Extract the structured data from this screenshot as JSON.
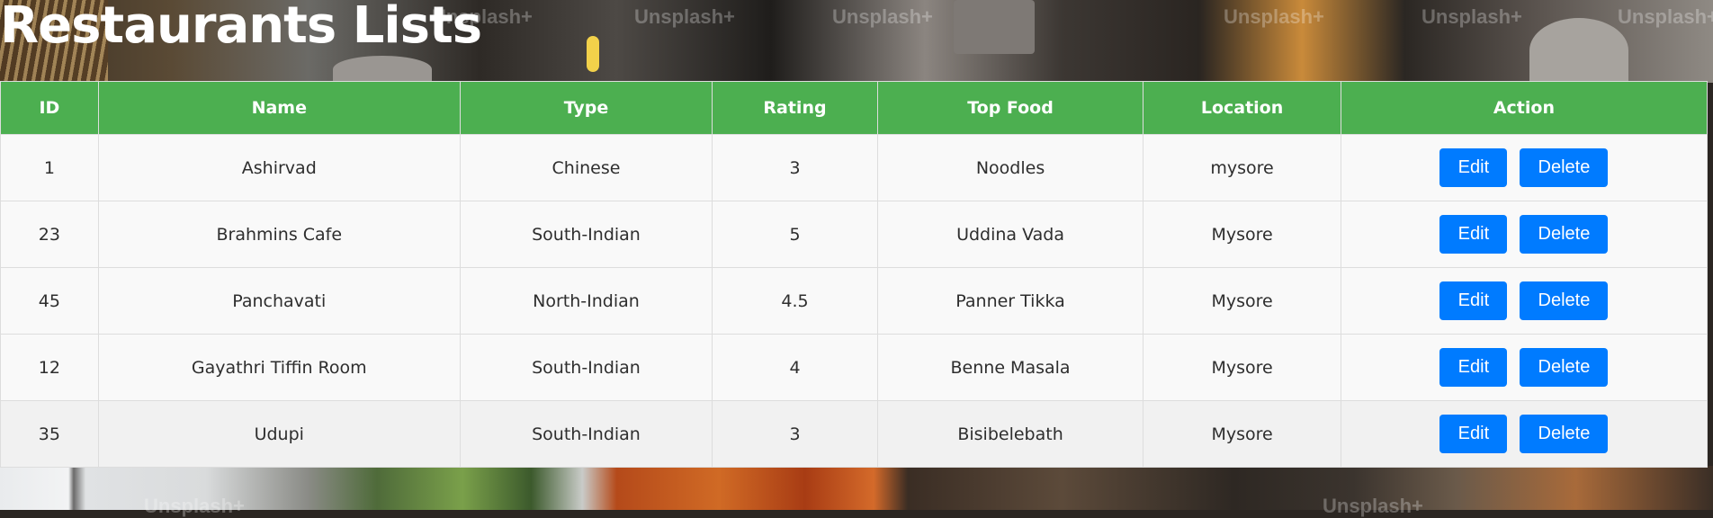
{
  "page": {
    "title": "Restaurants Lists",
    "watermark_text": "Unsplash+"
  },
  "colors": {
    "header_bg": "#4caf50",
    "button_bg": "#007bff",
    "row_bg": "#f9f9f9",
    "title_color": "#ffffff"
  },
  "table": {
    "columns": [
      "ID",
      "Name",
      "Type",
      "Rating",
      "Top Food",
      "Location",
      "Action"
    ],
    "edit_label": "Edit",
    "delete_label": "Delete",
    "rows": [
      {
        "id": "1",
        "name": "Ashirvad",
        "type": "Chinese",
        "rating": "3",
        "top_food": "Noodles",
        "location": "mysore"
      },
      {
        "id": "23",
        "name": "Brahmins Cafe",
        "type": "South-Indian",
        "rating": "5",
        "top_food": "Uddina Vada",
        "location": "Mysore"
      },
      {
        "id": "45",
        "name": "Panchavati",
        "type": "North-Indian",
        "rating": "4.5",
        "top_food": "Panner Tikka",
        "location": "Mysore"
      },
      {
        "id": "12",
        "name": "Gayathri Tiffin Room",
        "type": "South-Indian",
        "rating": "4",
        "top_food": "Benne Masala",
        "location": "Mysore"
      },
      {
        "id": "35",
        "name": "Udupi",
        "type": "South-Indian",
        "rating": "3",
        "top_food": "Bisibelebath",
        "location": "Mysore"
      }
    ]
  }
}
